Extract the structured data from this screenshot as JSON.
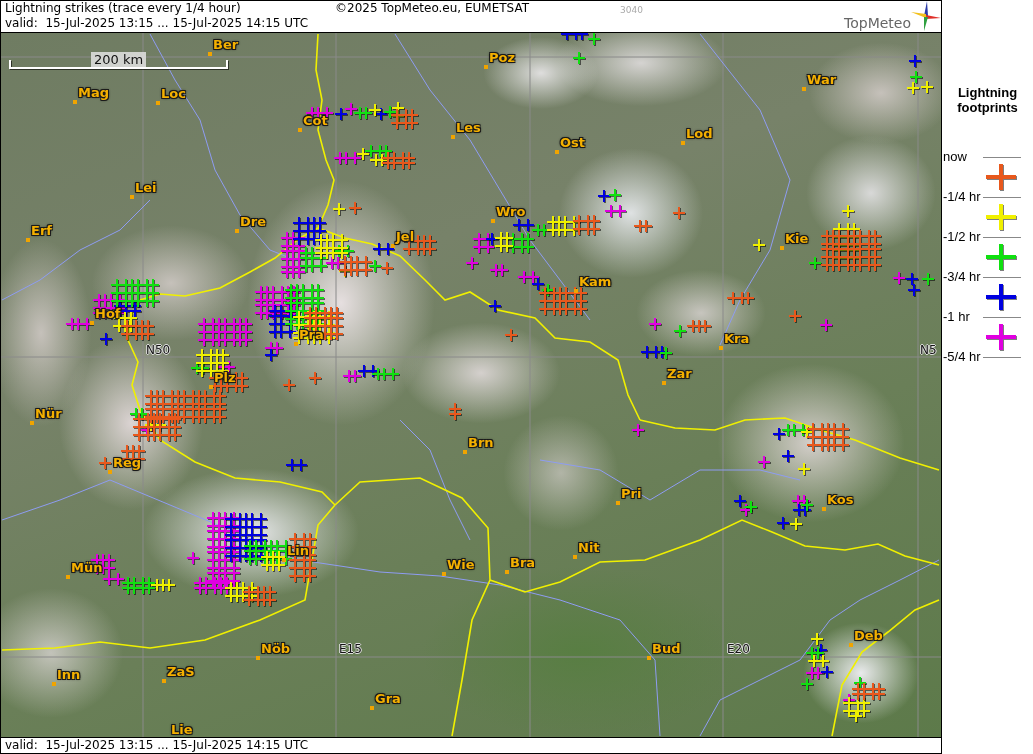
{
  "header": {
    "title": "Lightning strikes (trace every 1/4 hour)",
    "copyright": "©2025 TopMeteo.eu, EUMETSAT",
    "code": "3040",
    "logo": "TopMeteo",
    "validity": "valid:  15-Jul-2025 13:15 ... 15-Jul-2025 14:15 UTC"
  },
  "map": {
    "scale": "200 km",
    "cities": [
      "Ber",
      "Poz",
      "War",
      "Mag",
      "Loc",
      "Cot",
      "Les",
      "Ost",
      "Lod",
      "Lei",
      "Erf",
      "Dre",
      "Jel",
      "Wro",
      "Kie",
      "Kam",
      "Hof",
      "Pra",
      "Kra",
      "Plz",
      "Zar",
      "Nür",
      "Brn",
      "Reg",
      "Pri",
      "Kos",
      "Mün",
      "Lin",
      "Wie",
      "Bra",
      "Nit",
      "Nöb",
      "Bud",
      "Deb",
      "Inn",
      "ZaS",
      "Gra",
      "Lie"
    ],
    "grid_labels": [
      "N50",
      "N5",
      "E15",
      "E20"
    ]
  },
  "legend": {
    "title": "Lightning footprints",
    "times": [
      "now",
      "-1/4 hr",
      "-1/2 hr",
      "-3/4 hr",
      "-1 hr",
      "-5/4 hr"
    ],
    "classes": [
      {
        "color": "#e8581c"
      },
      {
        "color": "#f0f000"
      },
      {
        "color": "#10e010"
      },
      {
        "color": "#0000e0"
      },
      {
        "color": "#e000e0"
      }
    ]
  },
  "footer": {
    "validity": "valid:  15-Jul-2025 13:15 ... 15-Jul-2025 14:15 UTC"
  }
}
